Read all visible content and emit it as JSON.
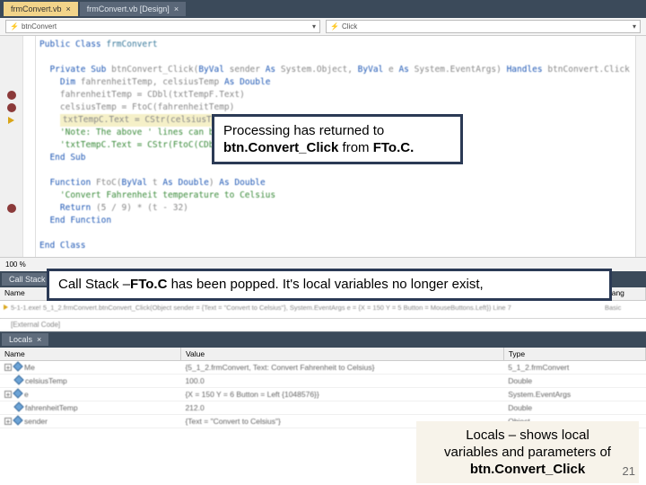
{
  "docTabs": {
    "active": "frmConvert.vb",
    "inactive": "frmConvert.vb [Design]"
  },
  "memberBar": {
    "left": "btnConvert",
    "right": "Click",
    "lightningIcon": "⚡"
  },
  "code": {
    "l1a": "Public Class",
    "l1b": " frmConvert",
    "l2a": "Private Sub",
    "l2b": " btnConvert_Click(",
    "l2c": "ByVal",
    "l2d": " sender ",
    "l2e": "As",
    "l2f": " System.Object, ",
    "l2g": "ByVal",
    "l2h": " e ",
    "l2i": "As",
    "l2j": " System.EventArgs) ",
    "l2k": "Handles",
    "l2l": " btnConvert.Click",
    "l3a": "Dim",
    "l3b": " fahrenheitTemp, celsiusTemp ",
    "l3c": "As Double",
    "l4": "fahrenheitTemp = CDbl(txtTempF.Text)",
    "l5": "celsiusTemp = FtoC(fahrenheitTemp)",
    "l6": "txtTempC.Text = CStr(celsiusTemp)",
    "l7a": "'Note: The above '",
    "l7b": "  lines can be repl",
    "l8a": "'txtTempC.Text = CStr(FtoC(CDbl(txtTemp",
    "l9": "End Sub",
    "l10a": "Function",
    "l10b": " FtoC(",
    "l10c": "ByVal",
    "l10d": " t ",
    "l10e": "As Double",
    "l10f": ") ",
    "l10g": "As Double",
    "l11a": "'Convert Fahrenheit temperature to Celsius",
    "l12a": "Return",
    "l12b": " (5 / 9) * (t - 32)",
    "l13": "End Function",
    "l14": "End Class"
  },
  "zoom": "100 %",
  "annotations": {
    "ret1": "Processing has returned to ",
    "ret2": "btn.Convert_Click",
    "ret3": " from ",
    "ret4": "FTo.C.",
    "cs1": "Call Stack –",
    "cs2": "FTo.C",
    "cs3": " has been popped. It's local variables no longer exist,",
    "lo1": "Locals – shows local",
    "lo2": "variables and parameters of",
    "lo3": "btn.Convert_Click"
  },
  "callStack": {
    "tab": "Call Stack",
    "colName": "Name",
    "colLang": "Lang",
    "row": "5-1-1.exe! 5_1_2.frmConvert.btnConvert_Click(Object sender = {Text = \"Convert to Celsius\"}, System.EventArgs e = {X = 150 Y = 5 Button = MouseButtons.Left}) Line 7",
    "rowLang": "Basic",
    "ext": "[External Code]"
  },
  "locals": {
    "tab": "Locals",
    "colName": "Name",
    "colValue": "Value",
    "colType": "Type",
    "rows": [
      {
        "expand": true,
        "name": "Me",
        "value": "{5_1_2.frmConvert, Text: Convert Fahrenheit to Celsius}",
        "type": "5_1_2.frmConvert"
      },
      {
        "expand": false,
        "name": "celsiusTemp",
        "value": "100.0",
        "type": "Double"
      },
      {
        "expand": true,
        "name": "e",
        "value": "{X = 150 Y = 6 Button = Left {1048576}}",
        "type": "System.EventArgs"
      },
      {
        "expand": false,
        "name": "fahrenheitTemp",
        "value": "212.0",
        "type": "Double"
      },
      {
        "expand": true,
        "name": "sender",
        "value": "{Text = \"Convert to Celsius\"}",
        "type": "Object"
      }
    ]
  },
  "slideNumber": "21"
}
